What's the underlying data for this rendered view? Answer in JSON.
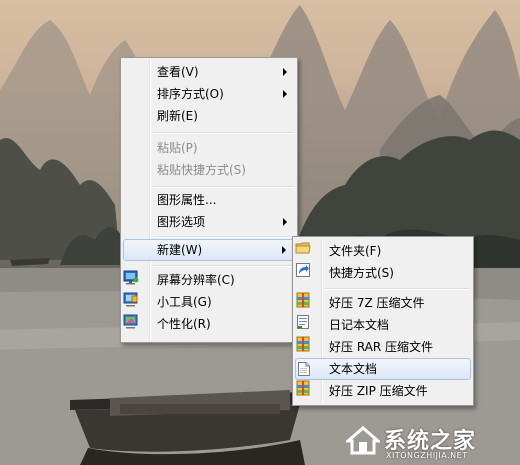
{
  "context_menu": {
    "items": [
      {
        "label": "查看(V)"
      },
      {
        "label": "排序方式(O)"
      },
      {
        "label": "刷新(E)"
      },
      {
        "label": "粘贴(P)"
      },
      {
        "label": "粘贴快捷方式(S)"
      },
      {
        "label": "图形属性..."
      },
      {
        "label": "图形选项"
      },
      {
        "label": "新建(W)"
      },
      {
        "label": "屏幕分辨率(C)",
        "icon": "display-settings-icon"
      },
      {
        "label": "小工具(G)",
        "icon": "gadgets-icon"
      },
      {
        "label": "个性化(R)",
        "icon": "personalize-icon"
      }
    ]
  },
  "new_submenu": {
    "items": [
      {
        "label": "文件夹(F)",
        "icon": "folder-icon"
      },
      {
        "label": "快捷方式(S)",
        "icon": "shortcut-icon"
      },
      {
        "label": "好压 7Z 压缩文件",
        "icon": "archive-icon"
      },
      {
        "label": "日记本文档",
        "icon": "journal-icon"
      },
      {
        "label": "好压 RAR 压缩文件",
        "icon": "archive-icon"
      },
      {
        "label": "文本文档",
        "icon": "text-document-icon"
      },
      {
        "label": "好压 ZIP 压缩文件",
        "icon": "archive-icon"
      }
    ]
  },
  "watermark": {
    "brand": "系统之家",
    "url": "XITONGZHIJIA.NET"
  },
  "colors": {
    "menu_bg": "#f0f0f0",
    "hover_bg": "#dce7f6",
    "hover_border": "#a8c3e6",
    "disabled_text": "#8d8d8d"
  }
}
